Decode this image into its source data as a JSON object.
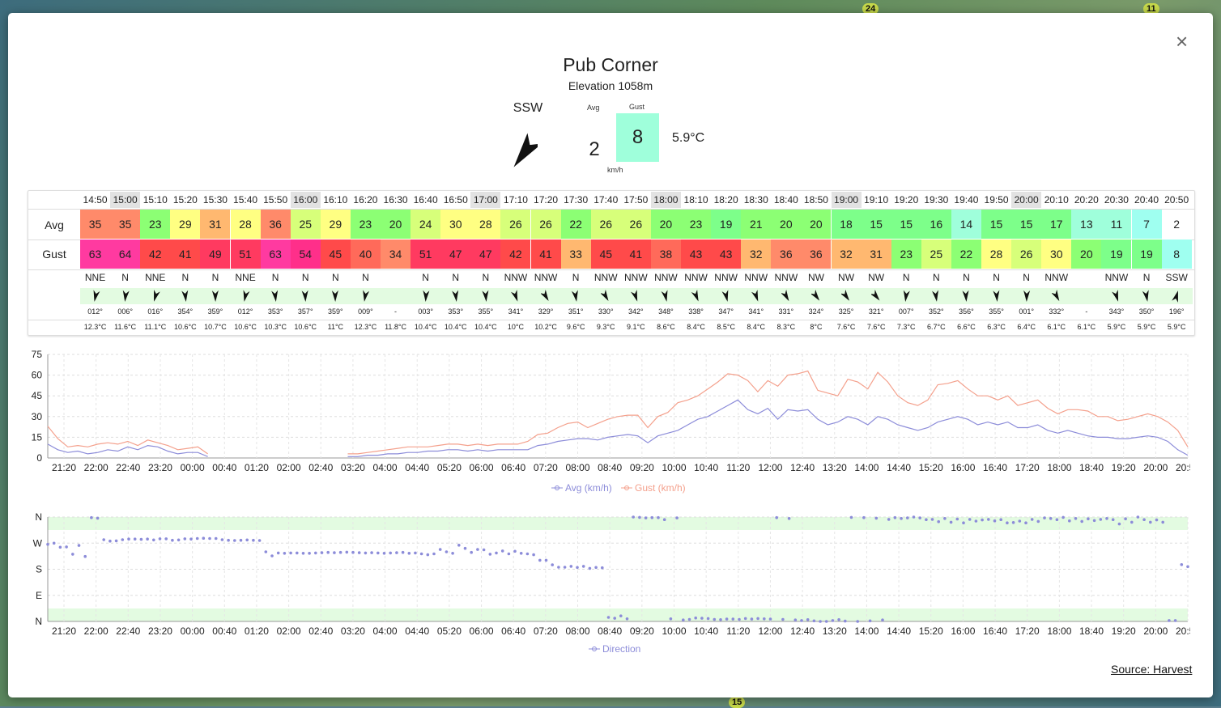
{
  "map": {
    "badges": [
      {
        "label": "24"
      },
      {
        "label": "11"
      },
      {
        "label": "15"
      }
    ]
  },
  "modal": {
    "title": "Pub Corner",
    "elevation": "Elevation 1058m",
    "close_label": "×",
    "source_label": "Source: Harvest"
  },
  "current": {
    "direction": "SSW",
    "direction_deg": 196,
    "avg_label": "Avg",
    "gust_label": "Gust",
    "avg": "2",
    "gust": "8",
    "unit": "km/h",
    "temperature": "5.9°C"
  },
  "colors": {
    "gust_current": "#9fffdb",
    "avg_line": "#8c8cd9",
    "gust_line": "#f4a08c",
    "direction_dot": "#8c8cd9",
    "direction_band": "#e3fbe1"
  },
  "table": {
    "row_labels": {
      "avg": "Avg",
      "gust": "Gust"
    },
    "times": [
      "14:50",
      "15:00",
      "15:10",
      "15:20",
      "15:30",
      "15:40",
      "15:50",
      "16:00",
      "16:10",
      "16:20",
      "16:30",
      "16:40",
      "16:50",
      "17:00",
      "17:10",
      "17:20",
      "17:30",
      "17:40",
      "17:50",
      "18:00",
      "18:10",
      "18:20",
      "18:30",
      "18:40",
      "18:50",
      "19:00",
      "19:10",
      "19:20",
      "19:30",
      "19:40",
      "19:50",
      "20:00",
      "20:10",
      "20:20",
      "20:30",
      "20:40",
      "20:50"
    ],
    "hour_marks": [
      1,
      7,
      13,
      19,
      25,
      31
    ],
    "avg": [
      "35",
      "35",
      "23",
      "29",
      "31",
      "28",
      "36",
      "25",
      "29",
      "23",
      "20",
      "24",
      "30",
      "28",
      "26",
      "26",
      "22",
      "26",
      "26",
      "20",
      "23",
      "19",
      "21",
      "20",
      "20",
      "18",
      "15",
      "15",
      "16",
      "14",
      "15",
      "15",
      "17",
      "13",
      "11",
      "7",
      "2"
    ],
    "gust": [
      "63",
      "64",
      "42",
      "41",
      "49",
      "51",
      "63",
      "54",
      "45",
      "40",
      "34",
      "51",
      "47",
      "47",
      "42",
      "41",
      "33",
      "45",
      "41",
      "38",
      "43",
      "43",
      "32",
      "36",
      "36",
      "32",
      "31",
      "23",
      "25",
      "22",
      "28",
      "26",
      "30",
      "20",
      "19",
      "19",
      "8"
    ],
    "dir_labels": [
      "NNE",
      "N",
      "NNE",
      "N",
      "N",
      "NNE",
      "N",
      "N",
      "N",
      "N",
      "",
      "N",
      "N",
      "N",
      "NNW",
      "NNW",
      "N",
      "NNW",
      "NNW",
      "NNW",
      "NNW",
      "NNW",
      "NNW",
      "NNW",
      "NW",
      "NW",
      "NW",
      "N",
      "N",
      "N",
      "N",
      "N",
      "NNW",
      "",
      "NNW",
      "N",
      "SSW"
    ],
    "dir_deg": [
      12,
      6,
      16,
      354,
      359,
      12,
      353,
      357,
      359,
      9,
      null,
      3,
      353,
      355,
      341,
      329,
      351,
      330,
      342,
      348,
      338,
      347,
      341,
      331,
      324,
      325,
      321,
      7,
      352,
      356,
      355,
      1,
      332,
      null,
      343,
      350,
      196
    ],
    "deg_labels": [
      "012°",
      "006°",
      "016°",
      "354°",
      "359°",
      "012°",
      "353°",
      "357°",
      "359°",
      "009°",
      "-",
      "003°",
      "353°",
      "355°",
      "341°",
      "329°",
      "351°",
      "330°",
      "342°",
      "348°",
      "338°",
      "347°",
      "341°",
      "331°",
      "324°",
      "325°",
      "321°",
      "007°",
      "352°",
      "356°",
      "355°",
      "001°",
      "332°",
      "-",
      "343°",
      "350°",
      "196°"
    ],
    "temps": [
      "12.3°C",
      "11.6°C",
      "11.1°C",
      "10.6°C",
      "10.7°C",
      "10.6°C",
      "10.3°C",
      "10.6°C",
      "11°C",
      "12.3°C",
      "11.8°C",
      "10.4°C",
      "10.4°C",
      "10.4°C",
      "10°C",
      "10.2°C",
      "9.6°C",
      "9.3°C",
      "9.1°C",
      "8.6°C",
      "8.4°C",
      "8.5°C",
      "8.4°C",
      "8.3°C",
      "8°C",
      "7.6°C",
      "7.6°C",
      "7.3°C",
      "6.7°C",
      "6.6°C",
      "6.3°C",
      "6.4°C",
      "6.1°C",
      "6.1°C",
      "5.9°C",
      "5.9°C",
      "5.9°C"
    ]
  },
  "chart_data": [
    {
      "type": "line",
      "title": "",
      "xlabel": "",
      "ylabel": "",
      "ylim": [
        0,
        75
      ],
      "yticks": [
        "0",
        "15",
        "30",
        "45",
        "60",
        "75"
      ],
      "xticks": [
        "21:20",
        "22:00",
        "22:40",
        "23:20",
        "00:00",
        "00:40",
        "01:20",
        "02:00",
        "02:40",
        "03:20",
        "04:00",
        "04:40",
        "05:20",
        "06:00",
        "06:40",
        "07:20",
        "08:00",
        "08:40",
        "09:20",
        "10:00",
        "10:40",
        "11:20",
        "12:00",
        "12:40",
        "13:20",
        "14:00",
        "14:40",
        "15:20",
        "16:00",
        "16:40",
        "17:20",
        "18:00",
        "18:40",
        "19:20",
        "20:00",
        "20:50"
      ],
      "x_hours": [
        0,
        0.67,
        1.33,
        2,
        2.67,
        3.33,
        4,
        4.67,
        5.33,
        6,
        6.67,
        7.33,
        8,
        8.67,
        9.33,
        10,
        10.67,
        11.33,
        12,
        12.67,
        13.33,
        14,
        14.67,
        15.33,
        16,
        16.67,
        17.33,
        18,
        18.67,
        19.33,
        20,
        20.67,
        21.33,
        22,
        22.67,
        23.33,
        24
      ],
      "series": [
        {
          "name": "Avg (km/h)",
          "values": [
            10,
            6,
            4,
            5,
            3,
            4,
            6,
            5,
            8,
            6,
            9,
            8,
            5,
            3,
            4,
            4,
            1,
            null,
            null,
            null,
            null,
            null,
            null,
            null,
            null,
            null,
            null,
            null,
            null,
            null,
            1,
            1,
            2,
            2,
            3,
            3,
            4,
            4,
            5,
            5,
            6,
            6,
            5,
            6,
            5,
            6,
            6,
            6,
            6,
            9,
            10,
            12,
            13,
            14,
            14,
            13,
            15,
            16,
            17,
            16,
            11,
            16,
            18,
            20,
            24,
            28,
            30,
            34,
            38,
            42,
            35,
            32,
            36,
            28,
            35,
            34,
            35,
            28,
            24,
            26,
            30,
            28,
            24,
            30,
            28,
            24,
            22,
            20,
            22,
            26,
            28,
            30,
            28,
            24,
            26,
            24,
            26,
            22,
            22,
            24,
            20,
            18,
            20,
            18,
            16,
            15,
            15,
            14,
            14,
            15,
            16,
            15,
            12,
            6,
            2
          ]
        },
        {
          "name": "Gust (km/h)",
          "values": [
            23,
            14,
            8,
            9,
            8,
            10,
            11,
            10,
            12,
            9,
            13,
            11,
            9,
            6,
            7,
            8,
            3,
            null,
            null,
            null,
            null,
            null,
            null,
            null,
            null,
            null,
            null,
            null,
            null,
            null,
            3,
            3,
            4,
            5,
            6,
            7,
            8,
            8,
            8,
            9,
            10,
            10,
            9,
            10,
            9,
            10,
            10,
            10,
            12,
            17,
            18,
            22,
            25,
            26,
            22,
            25,
            28,
            30,
            31,
            31,
            22,
            30,
            33,
            40,
            42,
            45,
            50,
            55,
            61,
            60,
            56,
            48,
            56,
            52,
            60,
            61,
            63,
            49,
            47,
            45,
            57,
            55,
            50,
            62,
            55,
            45,
            40,
            38,
            42,
            53,
            54,
            56,
            50,
            45,
            45,
            42,
            45,
            38,
            40,
            42,
            36,
            32,
            35,
            35,
            34,
            30,
            30,
            27,
            28,
            30,
            32,
            30,
            26,
            20,
            8
          ]
        }
      ]
    },
    {
      "type": "scatter",
      "title": "",
      "xlabel": "",
      "ylabel": "",
      "yticks": [
        "N",
        "W",
        "S",
        "E",
        "N"
      ],
      "ylim": [
        0,
        360
      ],
      "series": [
        {
          "name": "Direction",
          "values": [
            266,
            270,
            256,
            257,
            232,
            262,
            224,
            358,
            356,
            282,
            277,
            278,
            282,
            284,
            284,
            283,
            284,
            281,
            285,
            285,
            280,
            281,
            285,
            284,
            286,
            287,
            286,
            286,
            282,
            280,
            279,
            280,
            281,
            280,
            279,
            240,
            226,
            236,
            235,
            236,
            236,
            235,
            235,
            236,
            237,
            238,
            237,
            238,
            239,
            238,
            237,
            236,
            237,
            236,
            235,
            236,
            237,
            238,
            235,
            236,
            233,
            230,
            233,
            248,
            240,
            235,
            263,
            252,
            238,
            248,
            247,
            232,
            236,
            243,
            233,
            242,
            235,
            233,
            230,
            211,
            211,
            195,
            187,
            187,
            190,
            186,
            190,
            183,
            186,
            185,
            14,
            11,
            19,
            9,
            360,
            359,
            357,
            358,
            358,
            351,
            9,
            357,
            5,
            7,
            12,
            11,
            10,
            7,
            6,
            8,
            8,
            7,
            10,
            8,
            10,
            9,
            8,
            358,
            7,
            355,
            5,
            3,
            6,
            2,
            0,
            0,
            3,
            6,
            1,
            359,
            0,
            358,
            2,
            356,
            5,
            352,
            358,
            355,
            357,
            360,
            357,
            351,
            352,
            344,
            355,
            342,
            353,
            340,
            352,
            346,
            350,
            352,
            347,
            351,
            340,
            341,
            346,
            340,
            352,
            345,
            357,
            355,
            351,
            359,
            347,
            355,
            345,
            354,
            348,
            352,
            355,
            351,
            336,
            354,
            342,
            360,
            351,
            342,
            350,
            342,
            3,
            3,
            196,
            189
          ]
        }
      ]
    }
  ]
}
